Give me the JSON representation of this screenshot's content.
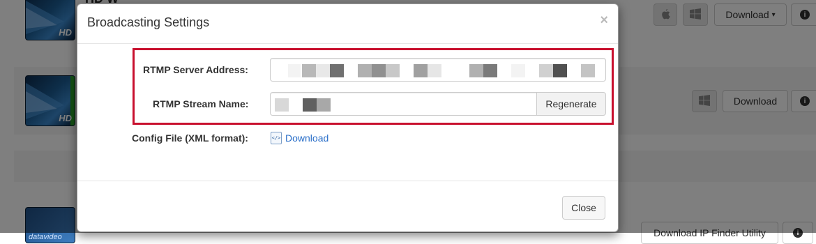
{
  "background": {
    "row1": {
      "title_fragment": "HD W",
      "download_label": "Download",
      "caret": "▾",
      "info_glyph": "i",
      "apple_icon": "apple-icon",
      "windows_icon": "windows-icon"
    },
    "row2": {
      "download_label": "Download",
      "info_glyph": "i",
      "windows_icon": "windows-icon"
    },
    "row3": {
      "download_ip_label": "Download IP Finder Utility",
      "info_glyph": "i"
    },
    "thumb_badge": "HD",
    "thumb_brand": "datavideo"
  },
  "modal": {
    "title": "Broadcasting Settings",
    "close_glyph": "×",
    "rtmp_server_label": "RTMP Server Address:",
    "rtmp_stream_label": "RTMP Stream Name:",
    "regenerate_label": "Regenerate",
    "config_label": "Config File (XML format):",
    "config_icon_glyph": "</>",
    "config_download_label": "Download",
    "close_button_label": "Close",
    "highlight_color": "#c8102e",
    "link_color": "#2a6fc9"
  }
}
